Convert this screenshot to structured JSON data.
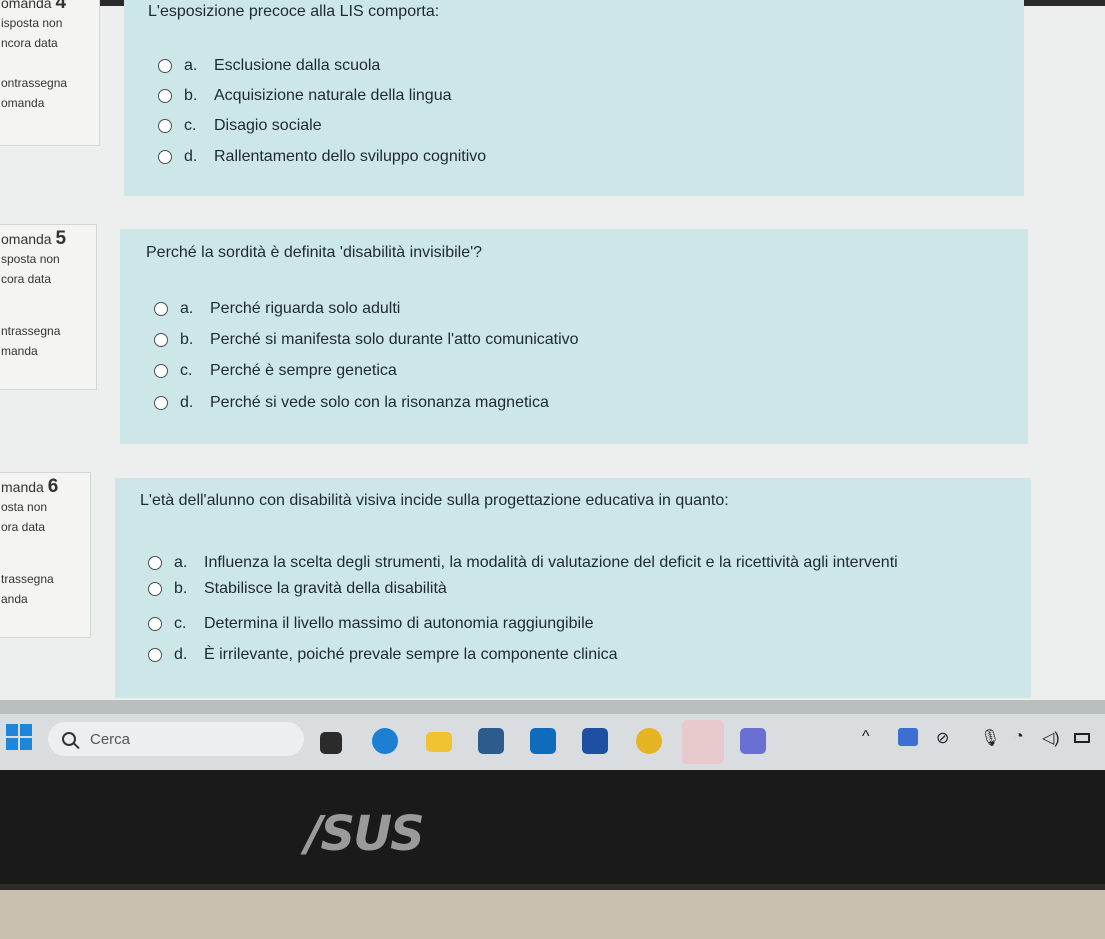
{
  "questions": [
    {
      "info": {
        "num_label": "omanda",
        "number": "4",
        "status_1": "isposta non",
        "status_2": "ncora data",
        "flag_1": "ontrassegna",
        "flag_2": "omanda"
      },
      "text": "L'esposizione precoce alla LIS comporta:",
      "options": [
        {
          "letter": "a.",
          "text": "Esclusione dalla scuola"
        },
        {
          "letter": "b.",
          "text": "Acquisizione naturale della lingua"
        },
        {
          "letter": "c.",
          "text": "Disagio sociale"
        },
        {
          "letter": "d.",
          "text": "Rallentamento dello sviluppo cognitivo"
        }
      ]
    },
    {
      "info": {
        "num_label": "omanda",
        "number": "5",
        "status_1": "sposta non",
        "status_2": "cora data",
        "flag_1": "ntrassegna",
        "flag_2": "manda"
      },
      "text": "Perché la sordità è definita 'disabilità invisibile'?",
      "options": [
        {
          "letter": "a.",
          "text": "Perché riguarda solo adulti"
        },
        {
          "letter": "b.",
          "text": "Perché si manifesta solo durante l'atto comunicativo"
        },
        {
          "letter": "c.",
          "text": "Perché è sempre genetica"
        },
        {
          "letter": "d.",
          "text": "Perché si vede solo con la risonanza magnetica"
        }
      ]
    },
    {
      "info": {
        "num_label": "manda",
        "number": "6",
        "status_1": "osta non",
        "status_2": "ora data",
        "flag_1": "trassegna",
        "flag_2": "anda"
      },
      "text": "L'età dell'alunno con disabilità visiva incide sulla progettazione educativa in quanto:",
      "options": [
        {
          "letter": "a.",
          "text": "Influenza la scelta degli strumenti, la modalità di valutazione del deficit e la ricettività agli interventi"
        },
        {
          "letter": "b.",
          "text": "Stabilisce la gravità della disabilità"
        },
        {
          "letter": "c.",
          "text": "Determina il livello massimo di autonomia raggiungibile"
        },
        {
          "letter": "d.",
          "text": "È irrilevante, poiché prevale sempre la componente clinica"
        }
      ]
    }
  ],
  "taskbar": {
    "search_placeholder": "Cerca",
    "icons": [
      "start-icon",
      "search-icon",
      "taskview-icon",
      "edge-icon",
      "file-explorer-icon",
      "store-icon",
      "outlook-icon",
      "app-icon",
      "chrome-icon",
      "teams-icon",
      "teams-work-icon"
    ],
    "tray_icons": [
      "chevron-up-icon",
      "shield-warning-icon",
      "notifications-off-icon",
      "microphone-icon",
      "wifi-icon",
      "volume-icon",
      "battery-icon"
    ]
  },
  "brand": {
    "logo_text": "/SUS"
  },
  "colors": {
    "question_bg": "#cde6e8",
    "info_bg": "#f4f5f3",
    "taskbar_bg": "#d9dde0",
    "page_bg": "#ecefee"
  }
}
